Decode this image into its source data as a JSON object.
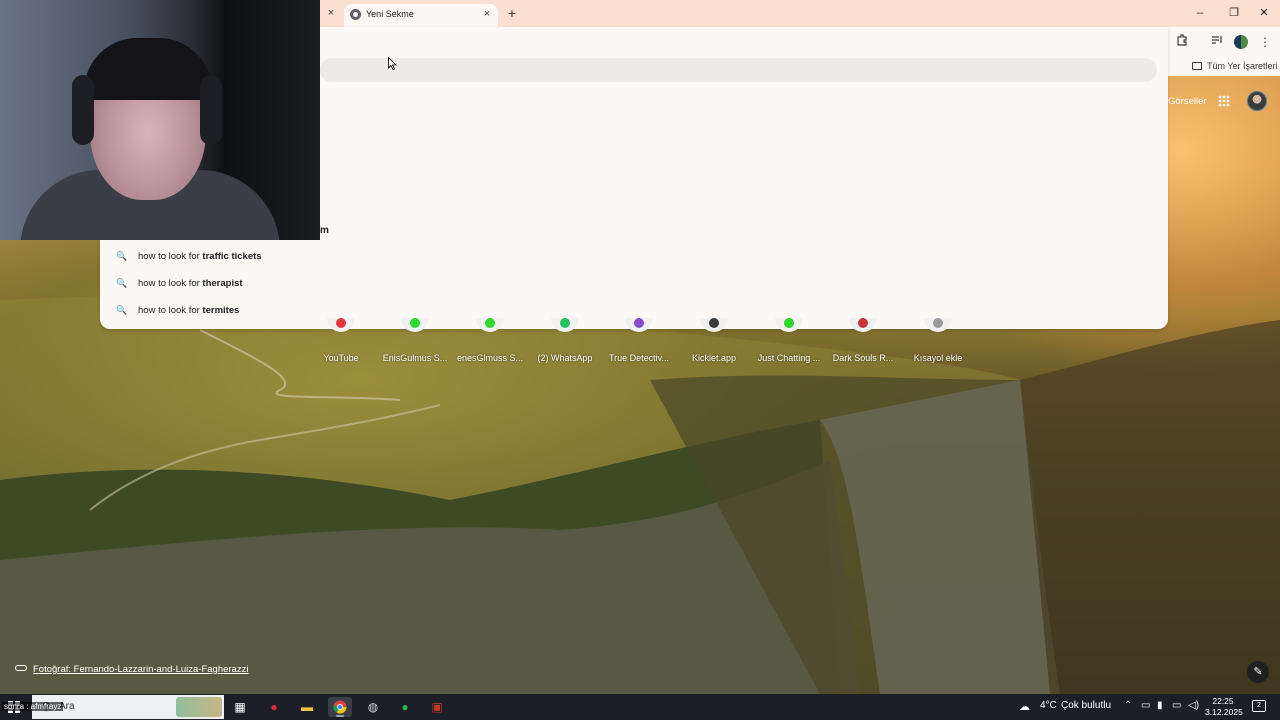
{
  "browser": {
    "tab_title": "Yeni Sekme",
    "close_glyph": "×",
    "new_tab_glyph": "+",
    "window_controls": {
      "minimize": "–",
      "restore": "❐",
      "close": "✕"
    },
    "toolbar_icons": {
      "extensions": "extensions-icon",
      "media": "media-icon",
      "menu": "⋮"
    },
    "bookmarks_all_label": "Tüm Yer İşaretleri"
  },
  "omnibox": {
    "partial_text": "m",
    "suggestions": [
      {
        "prefix": "how to look for ",
        "bold": "traffic tickets"
      },
      {
        "prefix": "how to look for ",
        "bold": "therapist"
      },
      {
        "prefix": "how to look for ",
        "bold": "termites"
      }
    ],
    "suggestion_icon": "🔍"
  },
  "ntp": {
    "images_label": "Görseller",
    "shortcuts": [
      {
        "label": "YouTube",
        "color": "#e0383e"
      },
      {
        "label": "EnisGulmus S...",
        "color": "#2bd82b"
      },
      {
        "label": "enesGlmuss S...",
        "color": "#2bd82b"
      },
      {
        "label": "(2) WhatsApp",
        "color": "#25c25f"
      },
      {
        "label": "True Detectiv...",
        "color": "#8a4ad0"
      },
      {
        "label": "Kicklet.app",
        "color": "#3c3c3c"
      },
      {
        "label": "Just Chatting ...",
        "color": "#2bd82b"
      },
      {
        "label": "Dark Souls R...",
        "color": "#c8343c"
      },
      {
        "label": "Kısayol ekle",
        "color": "#9a9a9a"
      }
    ],
    "photo_credit": "Fotoğraf: Fernando-Lazzarin-and-Luiza-Fagherazzi",
    "edit_glyph": "✎"
  },
  "taskbar": {
    "search_placeholder": "Ara",
    "overlay_name": "sonra : afmfrayz",
    "weather_temp": "4°C",
    "weather_text": "Çok bulutlu",
    "time": "22:25",
    "date": "3.12.2025",
    "notification_count": "2"
  }
}
